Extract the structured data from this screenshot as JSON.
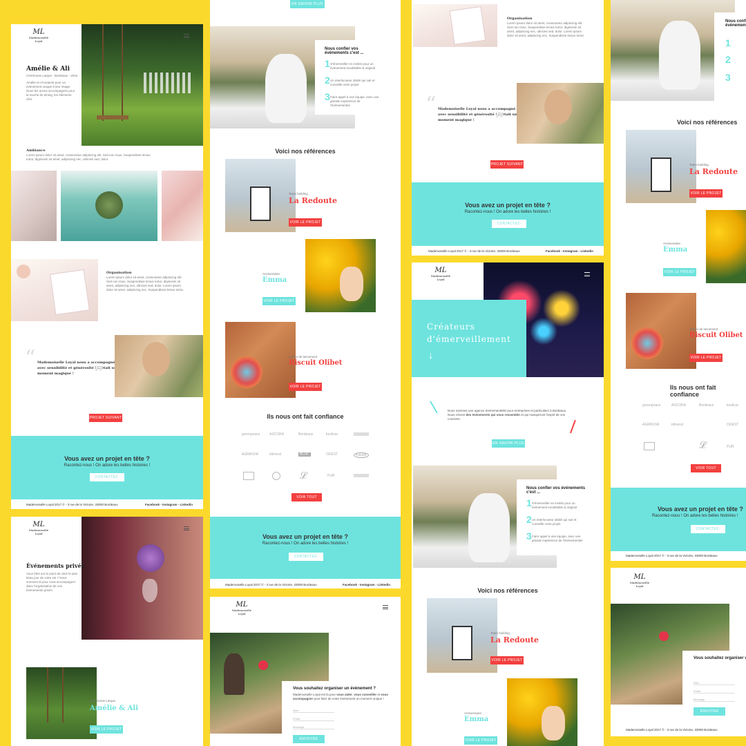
{
  "brand": {
    "logo_mark": "ML",
    "logo_text": "Mademoiselle Loyal"
  },
  "colors": {
    "background": "#fbd92c",
    "accent_red": "#f2403f",
    "accent_teal": "#6ee3de"
  },
  "panel1": {
    "title": "Amélie & Ali",
    "subtitle": "Cérémonie Laïque - Bordeaux - 2015",
    "intro": "Amélie et Ali avaient pour un événement unique à leur image. Nous les avons accompagnés pour la touche du timing, les éléments clés.",
    "ambiance_title": "Ambiance",
    "ambiance_text": "Lorem ipsum dolor sit amet, consectetur adipiscing elit. Sed non risus. Suspendisse lectus tortor, dignissim sit amet, adipiscing nec, ultricies sed, dolor.",
    "orga_title": "Organisation",
    "orga_text": "Lorem ipsum dolor sit amet, consectetur adipiscing elit. Sed non risus. Suspendisse lectus tortor, dignissim sit amet, adipiscing nec, ultricies sed, dolor. Lorem ipsum dolor sit amet, adipiscing nec. Suspendisse lectus tortor.",
    "quote": "Mademoiselle Loyal nous a accompagné avec sensibilité et générosité ! C'était un moment magique !",
    "next_button": "PROJET SUIVANT"
  },
  "cta": {
    "title": "Vous avez un projet en tête ?",
    "subtitle": "Racontez-nous ! On adore les belles histoires !",
    "button": "CONTACTEZ-NOUS"
  },
  "footer": {
    "address": "Mademoiselle Loyal 2017 © - 3 rue de la Victoire, 33000 Bordeaux",
    "social": "Facebook - Instagram - Linkedin"
  },
  "panel2": {
    "top_button": "EN SAVOIR PLUS",
    "trust_title": "Nous confier vos événements c'est ...",
    "trust_items": [
      {
        "num": "1",
        "text": "S'émerveiller en invités pour un événement inoubliable & original"
      },
      {
        "num": "2",
        "text": "Un interlocuteur dédié qui suit et conseille votre projet"
      },
      {
        "num": "3",
        "text": "Faire appel à une équipe, avec une grande expérience de l'événementiel"
      }
    ],
    "refs_title": "Voici nos références",
    "refs": [
      {
        "kicker": "Team building",
        "name": "La Redoute",
        "button": "VOIR LE PROJET"
      },
      {
        "kicker": "Anniversaire",
        "name": "Emma",
        "button": "VOIR LE PROJET"
      },
      {
        "kicker": "Soirée de lancement",
        "name": "Biscuit Olibet",
        "button": "VOIR LE PROJET"
      }
    ],
    "partners_title": "Ils nous ont fait confiance",
    "partners": [
      "greenpeace",
      "ASCORA",
      "Bordeaux",
      "koolicar",
      "",
      "AGRIKOIA",
      "idinvest",
      "BLOC",
      "OUEST",
      "Kasuta",
      "",
      "",
      "",
      "PUR",
      ""
    ],
    "see_all": "VOIR TOUT"
  },
  "panel3": {
    "hero_title": "Créateurs d'émerveillement",
    "intro_lead": "Nous sommes une agence événementielle pour entreprises et particuliers à Bordeaux. Nous créons ",
    "intro_bold": "des événements qui vous ressemble",
    "intro_tail": " et qui marqueront l'esprit de vos convives.",
    "more_button": "EN SAVOIR PLUS"
  },
  "panel5": {
    "title": "Événements privés",
    "text": "Vous êtes sur le point de vivre le plus beau jour de votre vie ? Nous sommes là pour vous accompagner dans l'organisation de vos événements privés.",
    "ref_kicker": "Cérémonie Laïque",
    "ref_name": "Amélie & Ali",
    "ref_button": "VOIR LE PROJET"
  },
  "contact": {
    "title": "Vous souhaitez organiser un événement ?",
    "text_lead": "Mademoiselle Loyal est là pour ",
    "text_bold1": "vous aider",
    "text_mid": ", ",
    "text_bold2": "vous conseiller",
    "text_and": " et ",
    "text_bold3": "vous accompagner",
    "text_tail": " pour faire de votre événement un moment unique !",
    "fields": [
      "Nom",
      "Email",
      "Message"
    ],
    "submit": "ENVOYER"
  }
}
